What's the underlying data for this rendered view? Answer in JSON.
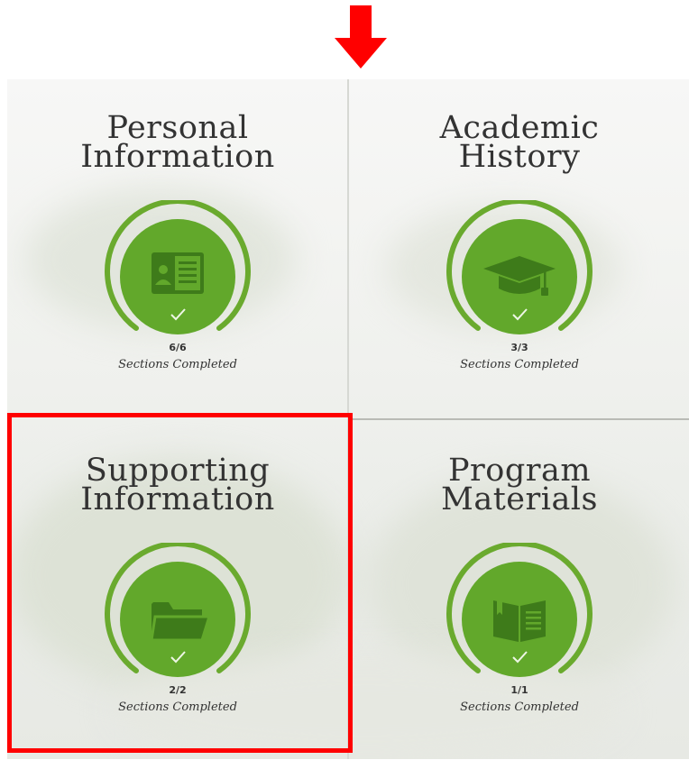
{
  "tiles": [
    {
      "title_line1": "Personal",
      "title_line2": "Information",
      "count": "6/6",
      "caption": "Sections Completed",
      "icon": "id-card-icon"
    },
    {
      "title_line1": "Academic",
      "title_line2": "History",
      "count": "3/3",
      "caption": "Sections Completed",
      "icon": "graduation-cap-icon"
    },
    {
      "title_line1": "Supporting",
      "title_line2": "Information",
      "count": "2/2",
      "caption": "Sections Completed",
      "icon": "folder-icon"
    },
    {
      "title_line1": "Program",
      "title_line2": "Materials",
      "count": "1/1",
      "caption": "Sections Completed",
      "icon": "book-icon"
    }
  ],
  "colors": {
    "ring": "#6aaa2e",
    "circle": "#62a82b",
    "icon_dark": "#3e7b1a",
    "highlight": "#ff0000",
    "arrow": "#ff0000"
  }
}
